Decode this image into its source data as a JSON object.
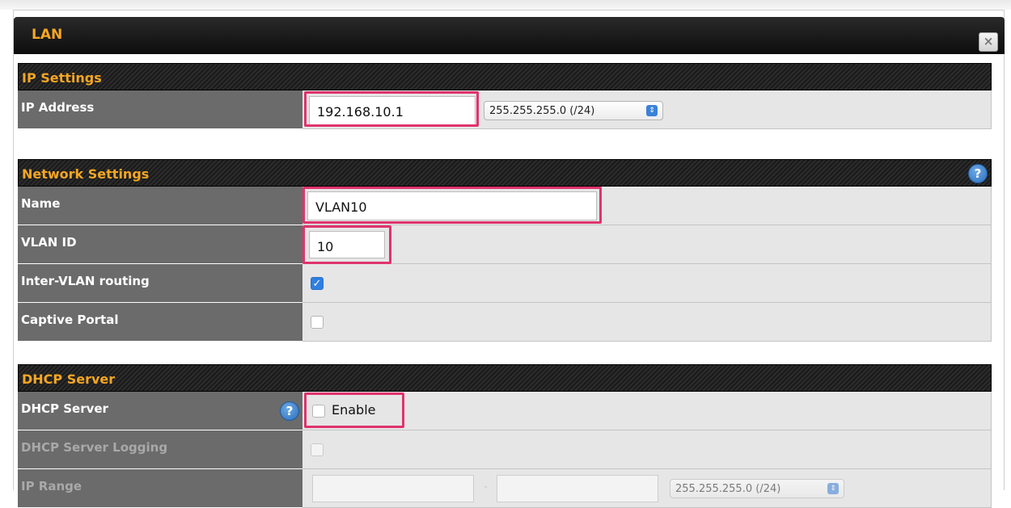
{
  "dialog": {
    "title": "LAN",
    "close_label": "×"
  },
  "ip_settings": {
    "title": "IP Settings",
    "ip_address_label": "IP Address",
    "ip_address_value": "192.168.10.1",
    "subnet_value": "255.255.255.0 (/24)"
  },
  "network_settings": {
    "title": "Network Settings",
    "help": "?",
    "name_label": "Name",
    "name_value": "VLAN10",
    "vlan_id_label": "VLAN ID",
    "vlan_id_value": "10",
    "inter_vlan_label": "Inter-VLAN routing",
    "inter_vlan_checked": true,
    "captive_portal_label": "Captive Portal",
    "captive_portal_checked": false
  },
  "dhcp_server": {
    "title": "DHCP Server",
    "server_label": "DHCP Server",
    "help": "?",
    "enable_label": "Enable",
    "enable_checked": false,
    "logging_label": "DHCP Server Logging",
    "ip_range_label": "IP Range",
    "ip_range_start": "",
    "ip_range_separator": "-",
    "ip_range_end": "",
    "ip_range_subnet": "255.255.255.0 (/24)"
  },
  "colors": {
    "accent_orange": "#f5a623",
    "highlight_pink": "#e0336e",
    "checkbox_blue": "#2f7fe0",
    "help_blue": "#3b82d8"
  }
}
